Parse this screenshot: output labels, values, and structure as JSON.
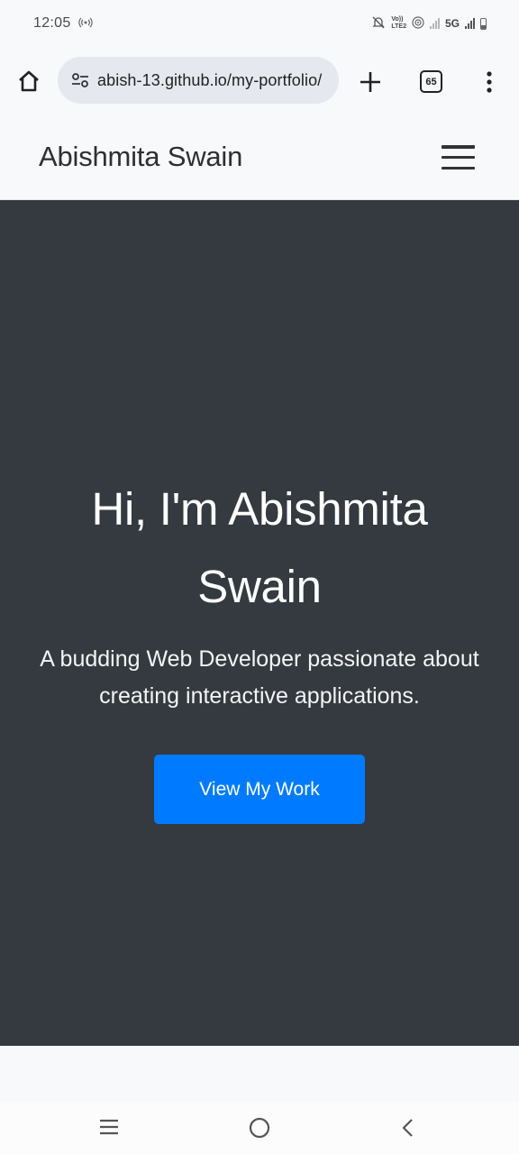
{
  "status_bar": {
    "time": "12:05",
    "network_label": "5G"
  },
  "browser": {
    "url": "abish-13.github.io/my-portfolio/",
    "tab_count": "65"
  },
  "navbar": {
    "brand": "Abishmita Swain"
  },
  "hero": {
    "title": "Hi, I'm Abishmita Swain",
    "subtitle": "A budding Web Developer passionate about creating interactive applications.",
    "cta_label": "View My Work",
    "background_color": "#343a40",
    "cta_color": "#007bff"
  },
  "icons": {
    "home": "home-icon",
    "site_settings": "tune-icon",
    "new_tab": "plus-icon",
    "tabs": "tab-switcher-icon",
    "menu": "more-vert-icon",
    "hamburger": "hamburger-menu-icon",
    "nav_recents": "recents-icon",
    "nav_home": "circle-home-icon",
    "nav_back": "back-chevron-icon"
  }
}
